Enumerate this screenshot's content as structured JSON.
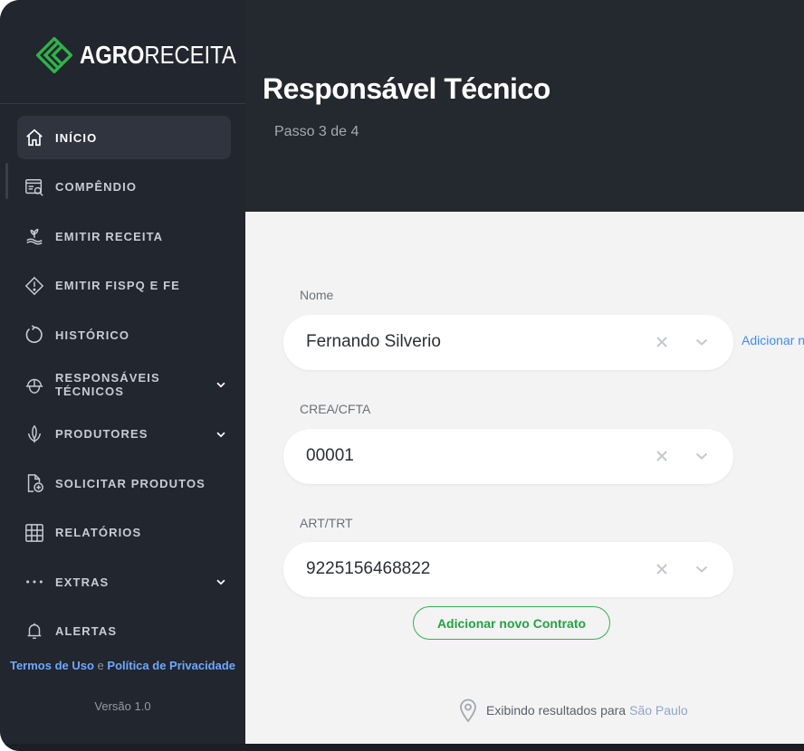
{
  "brand": {
    "bold": "AGRO",
    "light": "RECEITA",
    "accent": "#2fb34a"
  },
  "sidebar": {
    "items": [
      {
        "label": "INÍCIO",
        "icon": "home-icon",
        "active": true
      },
      {
        "label": "COMPÊNDIO",
        "icon": "compendium-icon"
      },
      {
        "label": "EMITIR RECEITA",
        "icon": "plant-hand-icon"
      },
      {
        "label": "EMITIR FISPQ E FE",
        "icon": "warning-diamond-icon"
      },
      {
        "label": "HISTÓRICO",
        "icon": "history-icon"
      },
      {
        "label": "RESPONSÁVEIS TÉCNICOS",
        "icon": "helmet-icon",
        "expandable": true
      },
      {
        "label": "PRODUTORES",
        "icon": "corn-icon",
        "expandable": true
      },
      {
        "label": "SOLICITAR PRODUTOS",
        "icon": "file-add-icon"
      },
      {
        "label": "RELATÓRIOS",
        "icon": "grid-icon"
      },
      {
        "label": "EXTRAS",
        "icon": "dots-icon",
        "expandable": true
      },
      {
        "label": "ALERTAS",
        "icon": "bell-icon"
      }
    ],
    "legal": {
      "terms": "Termos de Uso",
      "and": "e",
      "privacy": "Política de Privacidade"
    },
    "version": "Versão 1.0"
  },
  "header": {
    "title": "Responsável Técnico",
    "step": "Passo 3 de 4"
  },
  "form": {
    "nome": {
      "label": "Nome",
      "value": "Fernando Silverio"
    },
    "crea": {
      "label": "CREA/CFTA",
      "value": "00001"
    },
    "art": {
      "label": "ART/TRT",
      "value": "9225156468822"
    },
    "add_link": "Adicionar n",
    "add_contract": "Adicionar novo Contrato"
  },
  "location": {
    "prefix": "Exibindo resultados para",
    "city": "São Paulo"
  }
}
